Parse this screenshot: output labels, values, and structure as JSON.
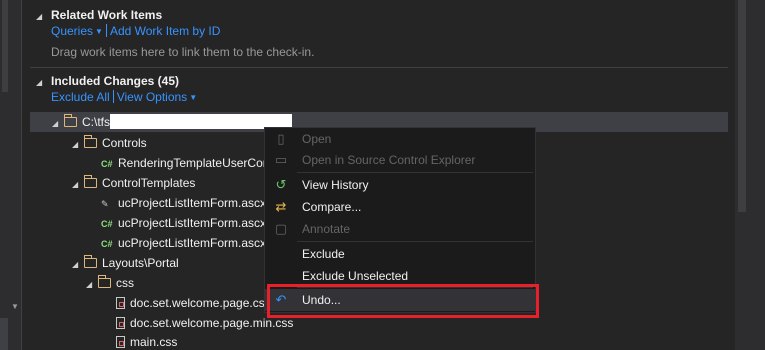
{
  "related": {
    "title": "Related Work Items",
    "queries": "Queries",
    "add_by_id": "Add Work Item by ID",
    "hint": "Drag work items here to link them to the check-in."
  },
  "included": {
    "title": "Included Changes (45)",
    "exclude_all": "Exclude All",
    "view_options": "View Options"
  },
  "tree": {
    "root": "C:\\tfs",
    "controls": "Controls",
    "rendering": "RenderingTemplateUserCon",
    "control_templates": "ControlTemplates",
    "file1": "ucProjectListItemForm.ascx",
    "file2": "ucProjectListItemForm.ascx",
    "file3": "ucProjectListItemForm.ascx",
    "layouts": "Layouts\\Portal",
    "css_folder": "css",
    "css1": "doc.set.welcome.page.css",
    "css2": "doc.set.welcome.page.min.css",
    "css3": "main.css"
  },
  "menu": {
    "open": "Open",
    "open_sce": "Open in Source Control Explorer",
    "view_history": "View History",
    "compare": "Compare...",
    "annotate": "Annotate",
    "exclude": "Exclude",
    "exclude_unselected": "Exclude Unselected",
    "undo": "Undo..."
  },
  "colors": {
    "background": "#252526",
    "link": "#3794ff",
    "highlight_box": "#e8202a"
  }
}
